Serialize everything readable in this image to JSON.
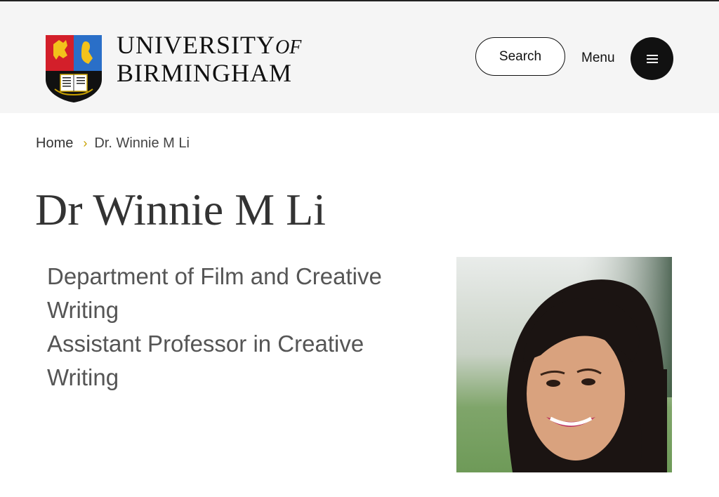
{
  "header": {
    "logo": {
      "line1": "UNIVERSITY",
      "of": "OF",
      "line2": "BIRMINGHAM",
      "crest_icon": "university-crest-icon"
    },
    "search_label": "Search",
    "menu_label": "Menu",
    "menu_icon": "hamburger-icon"
  },
  "breadcrumb": {
    "home": "Home",
    "current": "Dr. Winnie M Li",
    "separator_icon": "chevron-right-icon"
  },
  "profile": {
    "name": "Dr Winnie M Li",
    "department": "Department of Film and Creative Writing",
    "role": "Assistant Professor in Creative Writing",
    "photo": "profile-photo"
  },
  "colors": {
    "header_bg": "#f5f5f5",
    "text_dark": "#111111",
    "breadcrumb_chevron": "#c8a000"
  }
}
